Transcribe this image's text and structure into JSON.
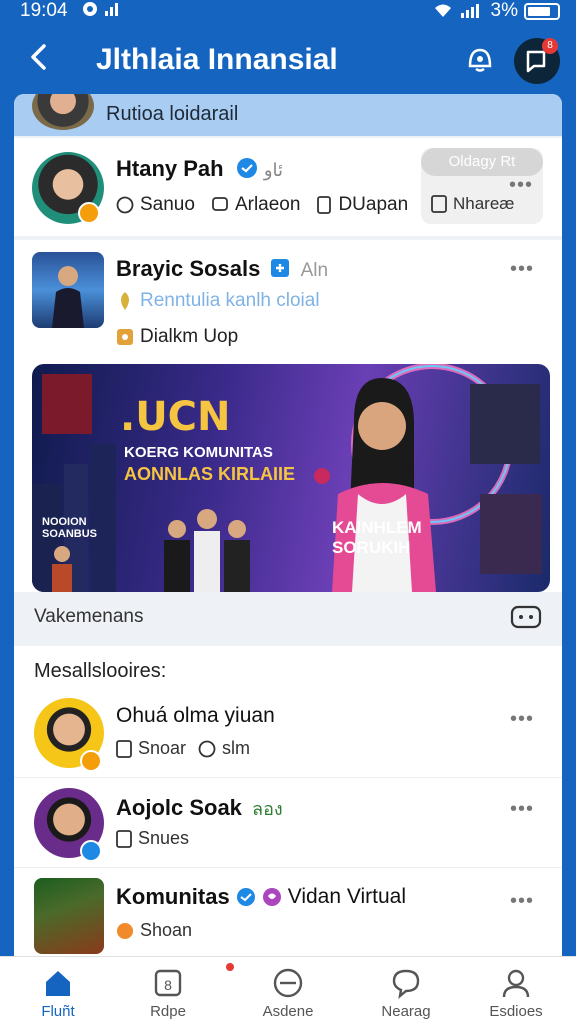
{
  "status_bar": {
    "time": "19:04",
    "battery": "3%"
  },
  "header": {
    "title": "Jlthlaia Innansial",
    "notification_badge": "8"
  },
  "strip": {
    "label": "Rutioa loidarail"
  },
  "profile_card": {
    "name": "Htany Pah",
    "name_suffix": "ئاو",
    "meta": [
      "Sanuo",
      "Arlaeon",
      "DUapan",
      "Nhareæ"
    ],
    "overlay_label": "Oldagy Rt"
  },
  "featured_card": {
    "name": "Brayic Sosals",
    "tag": "Aln",
    "subtitle": "Renntulia kanlh cloial",
    "meta": "Dialkm Uop",
    "banner": {
      "headline": ".UCN",
      "line1": "KOERG KOMUNITAS",
      "line2": "AONNLAS KIRLAIIE",
      "left_label": "NOOION SOANBUS",
      "right_label": "KAINHLEM SORUKIH"
    },
    "footer": "Vakemenans"
  },
  "section": {
    "title": "Mesallslooires:",
    "items": [
      {
        "name": "Ohuá olma yiuan",
        "meta1": "Snoar",
        "meta2": "slm"
      },
      {
        "name": "Aojolc Soak",
        "extra": "ลอง",
        "meta1": "Snues",
        "meta2": ""
      },
      {
        "name": "Komunitas",
        "extra": "Vidan Virtual",
        "meta1": "Shoan",
        "meta2": ""
      }
    ]
  },
  "bottom_nav": [
    {
      "label": "Fluñt",
      "active": true
    },
    {
      "label": "Rdpe",
      "active": false
    },
    {
      "label": "Asdene",
      "active": false
    },
    {
      "label": "Nearag",
      "active": false
    },
    {
      "label": "Esdioes",
      "active": false
    }
  ],
  "colors": {
    "brand": "#1565c0",
    "accent_green": "#2e7d32",
    "badge_red": "#e53935"
  }
}
